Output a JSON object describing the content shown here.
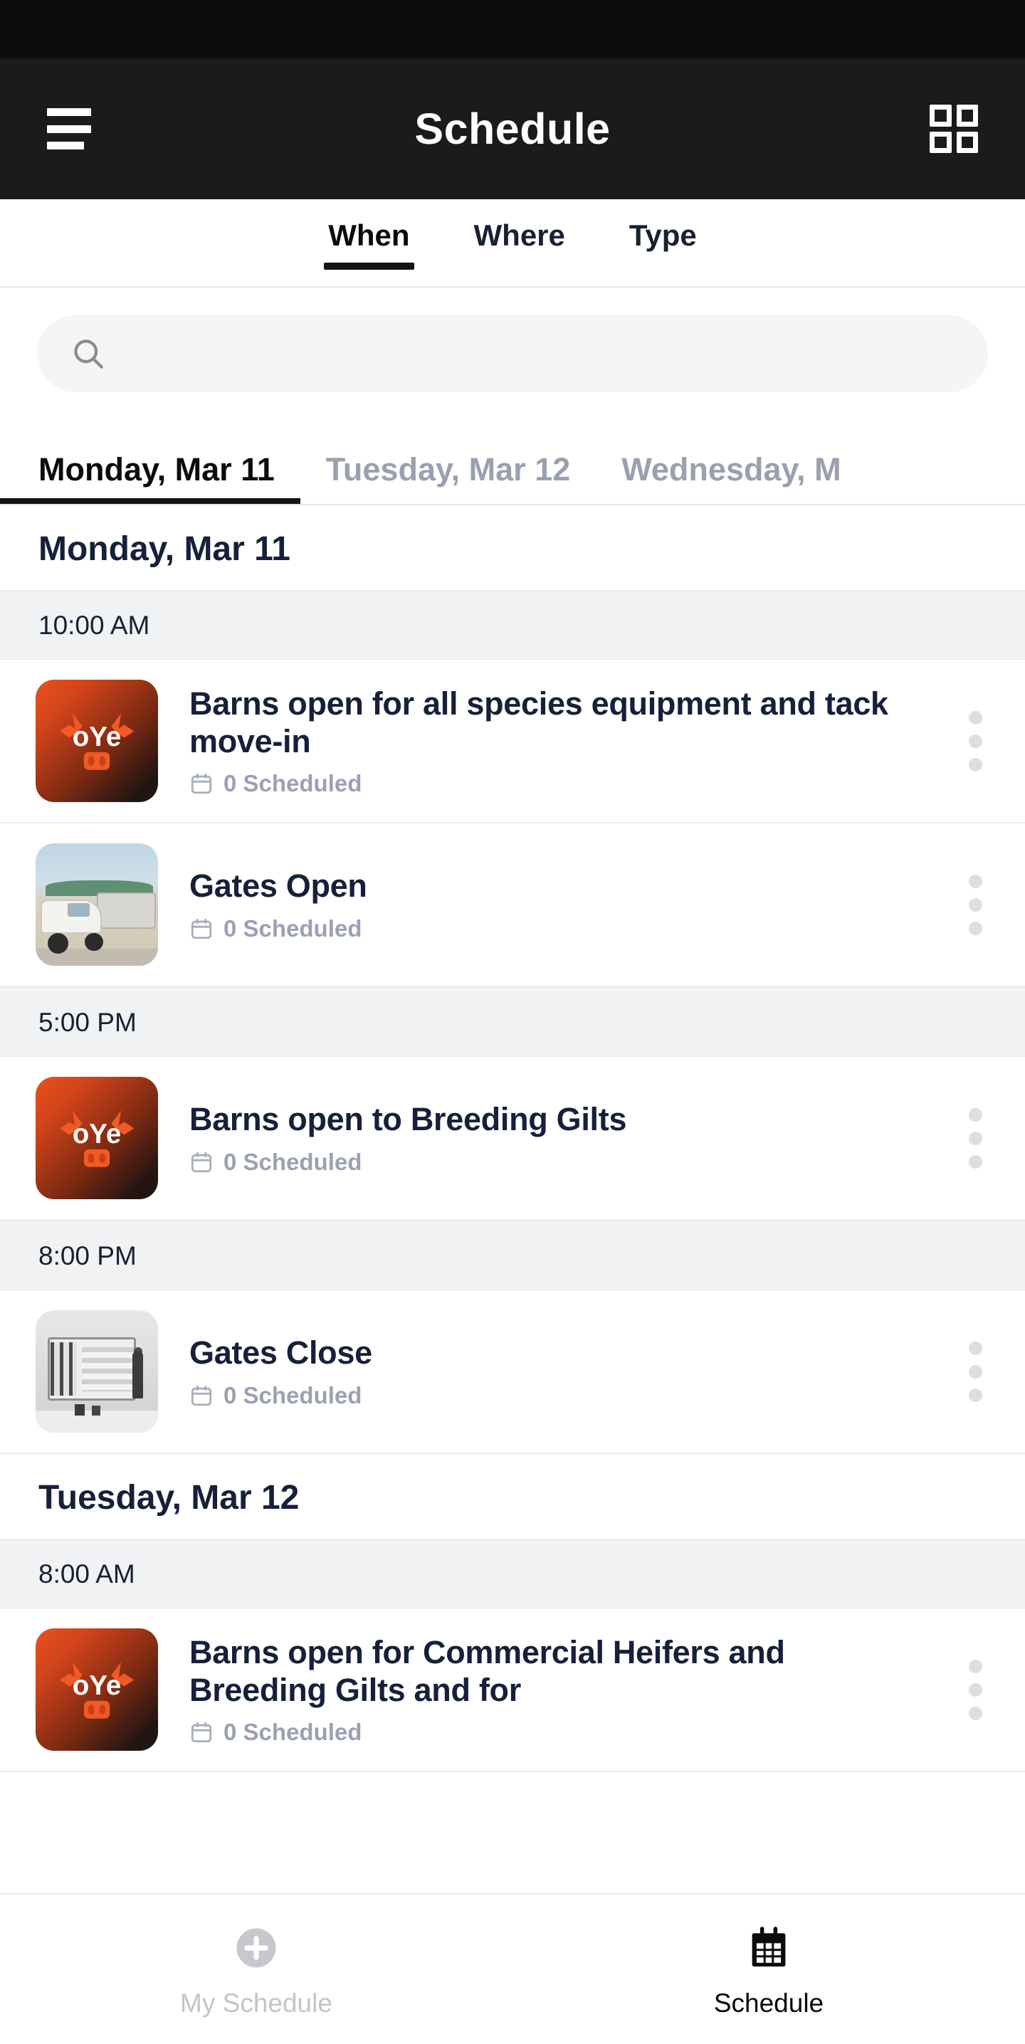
{
  "app": {
    "title": "Schedule",
    "brand_color": "#e8531d",
    "appbar_bg": "#1b1b1b"
  },
  "appbar": {
    "menu_icon": "hamburger-menu-icon",
    "title": "Schedule",
    "grid_icon": "grid-view-icon"
  },
  "filter_tabs": [
    {
      "label": "When",
      "active": true
    },
    {
      "label": "Where",
      "active": false
    },
    {
      "label": "Type",
      "active": false
    }
  ],
  "search": {
    "icon": "search-icon",
    "value": "",
    "placeholder": ""
  },
  "date_tabs": [
    {
      "label": "Monday, Mar 11",
      "active": true
    },
    {
      "label": "Tuesday, Mar 12",
      "active": false
    },
    {
      "label": "Wednesday, M",
      "active": false
    }
  ],
  "schedule": [
    {
      "day": "Monday, Mar 11",
      "time_blocks": [
        {
          "time": "10:00 AM",
          "events": [
            {
              "title": "Barns open for all species equipment and tack move-in",
              "meta_icon": "calendar-icon",
              "meta": "0 Scheduled",
              "thumb": "oye-logo",
              "menu_icon": "more-vertical-icon"
            },
            {
              "title": "Gates Open",
              "meta_icon": "calendar-icon",
              "meta": "0 Scheduled",
              "thumb": "truck-photo",
              "menu_icon": "more-vertical-icon"
            }
          ]
        },
        {
          "time": "5:00 PM",
          "events": [
            {
              "title": "Barns open to Breeding Gilts",
              "meta_icon": "calendar-icon",
              "meta": "0 Scheduled",
              "thumb": "oye-logo",
              "menu_icon": "more-vertical-icon"
            }
          ]
        },
        {
          "time": "8:00 PM",
          "events": [
            {
              "title": "Gates Close",
              "meta_icon": "calendar-icon",
              "meta": "0 Scheduled",
              "thumb": "trailer-bw-photo",
              "menu_icon": "more-vertical-icon"
            }
          ]
        }
      ]
    },
    {
      "day": "Tuesday, Mar 12",
      "time_blocks": [
        {
          "time": "8:00 AM",
          "events": [
            {
              "title": "Barns open for Commercial Heifers and Breeding Gilts and for",
              "meta_icon": "calendar-icon",
              "meta": "0 Scheduled",
              "thumb": "oye-logo",
              "menu_icon": "more-vertical-icon"
            }
          ]
        }
      ]
    }
  ],
  "bottom_nav": [
    {
      "label": "My Schedule",
      "icon": "plus-circle-icon",
      "active": false
    },
    {
      "label": "Schedule",
      "icon": "calendar-icon",
      "active": true
    }
  ]
}
